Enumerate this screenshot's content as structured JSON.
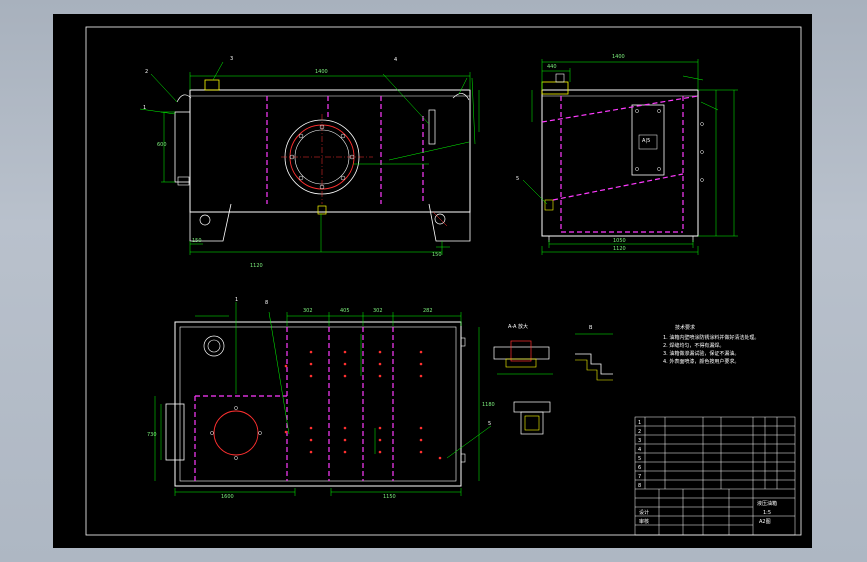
{
  "colors": {
    "background": "#000000",
    "outline": "#ffffff",
    "dimension": "#00ff00",
    "hidden": "#ff00ff",
    "center": "#ff0000",
    "accent": "#ffff00",
    "desktop": "#b1bac6"
  },
  "front_view": {
    "callouts": [
      "1",
      "2",
      "3",
      "4"
    ],
    "dim_top": "1400",
    "dim_bottom": "1120",
    "dim_left_small": "150",
    "dim_right_small": "150",
    "dim_height": "600"
  },
  "side_view": {
    "dim_top_overall": "1400",
    "dim_top_small": "440",
    "dim_bottom_inner": "1050",
    "dim_bottom_overall": "1120",
    "callout": "5",
    "plate_text": "A|5"
  },
  "plan_view": {
    "callouts": [
      "1",
      "8",
      "5"
    ],
    "dim_segments": [
      "302",
      "405",
      "302",
      "282"
    ],
    "dim_bottom_left": "1600",
    "dim_bottom_right": "1150",
    "dim_left": "730",
    "dim_right": "1180"
  },
  "sections": {
    "a_a_label": "A-A 放大",
    "b_label": "B"
  },
  "notes": {
    "title": "技术要求",
    "lines": [
      "1. 油箱内壁喷涂防锈涂料并做好清洁处理。",
      "2. 焊缝均匀，不得有漏焊。",
      "3. 油箱做渗漏试验，保证不漏油。",
      "4. 外表面喷漆，颜色按用户要求。"
    ]
  },
  "title_block": {
    "drawing_name": "液压油箱",
    "scale": "1:5",
    "sheet": "A2图",
    "row_labels": [
      "1",
      "2",
      "3",
      "4",
      "5",
      "6",
      "7",
      "8"
    ],
    "designer": "设计",
    "checker": "审核"
  }
}
